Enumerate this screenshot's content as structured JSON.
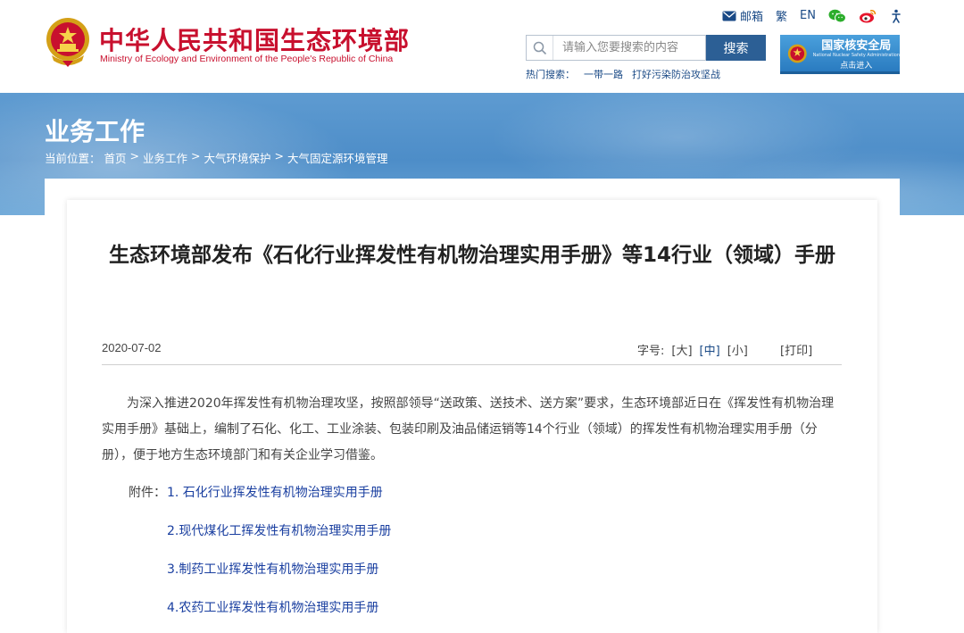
{
  "header": {
    "site_name_cn": "中华人民共和国生态环境部",
    "site_name_en": "Ministry of Ecology and Environment of the People's Republic of China",
    "toplinks": {
      "mail_label": "邮箱",
      "traditional_label": "繁",
      "english_label": "EN"
    },
    "search": {
      "placeholder": "请输入您要搜索的内容",
      "button_label": "搜索"
    },
    "hot_search": {
      "label": "热门搜索：",
      "items": [
        "一带一路",
        "打好污染防治攻坚战"
      ]
    },
    "nsa_banner": {
      "title": "国家核安全局",
      "subtitle_en": "National Nuclear Safety Administration",
      "enter_label": "点击进入"
    }
  },
  "banner": {
    "section_title": "业务工作",
    "breadcrumb": {
      "prefix": "当前位置：",
      "items": [
        "首页",
        "业务工作",
        "大气环境保护",
        "大气固定源环境管理"
      ],
      "separator": ">"
    }
  },
  "article": {
    "title": "生态环境部发布《石化行业挥发性有机物治理实用手册》等14行业（领域）手册",
    "date": "2020-07-02",
    "font_size": {
      "label": "字号:",
      "large": "[大]",
      "medium": "[中]",
      "small": "[小]"
    },
    "print_label": "[打印]",
    "paragraph": "为深入推进2020年挥发性有机物治理攻坚，按照部领导“送政策、送技术、送方案”要求，生态环境部近日在《挥发性有机物治理实用手册》基础上，编制了石化、化工、工业涂装、包装印刷及油品储运销等14个行业（领域）的挥发性有机物治理实用手册（分册），便于地方生态环境部门和有关企业学习借鉴。",
    "attachment_label": "附件：",
    "attachments": [
      "1. 石化行业挥发性有机物治理实用手册",
      "2.现代煤化工挥发性有机物治理实用手册",
      "3.制药工业挥发性有机物治理实用手册",
      "4.农药工业挥发性有机物治理实用手册"
    ]
  },
  "colors": {
    "brand_red": "#c8102e",
    "link_blue": "#1a4a86",
    "attachment_blue": "#1a3fa0",
    "search_button": "#2c5f95",
    "banner_blue": "#4d8dc8"
  }
}
